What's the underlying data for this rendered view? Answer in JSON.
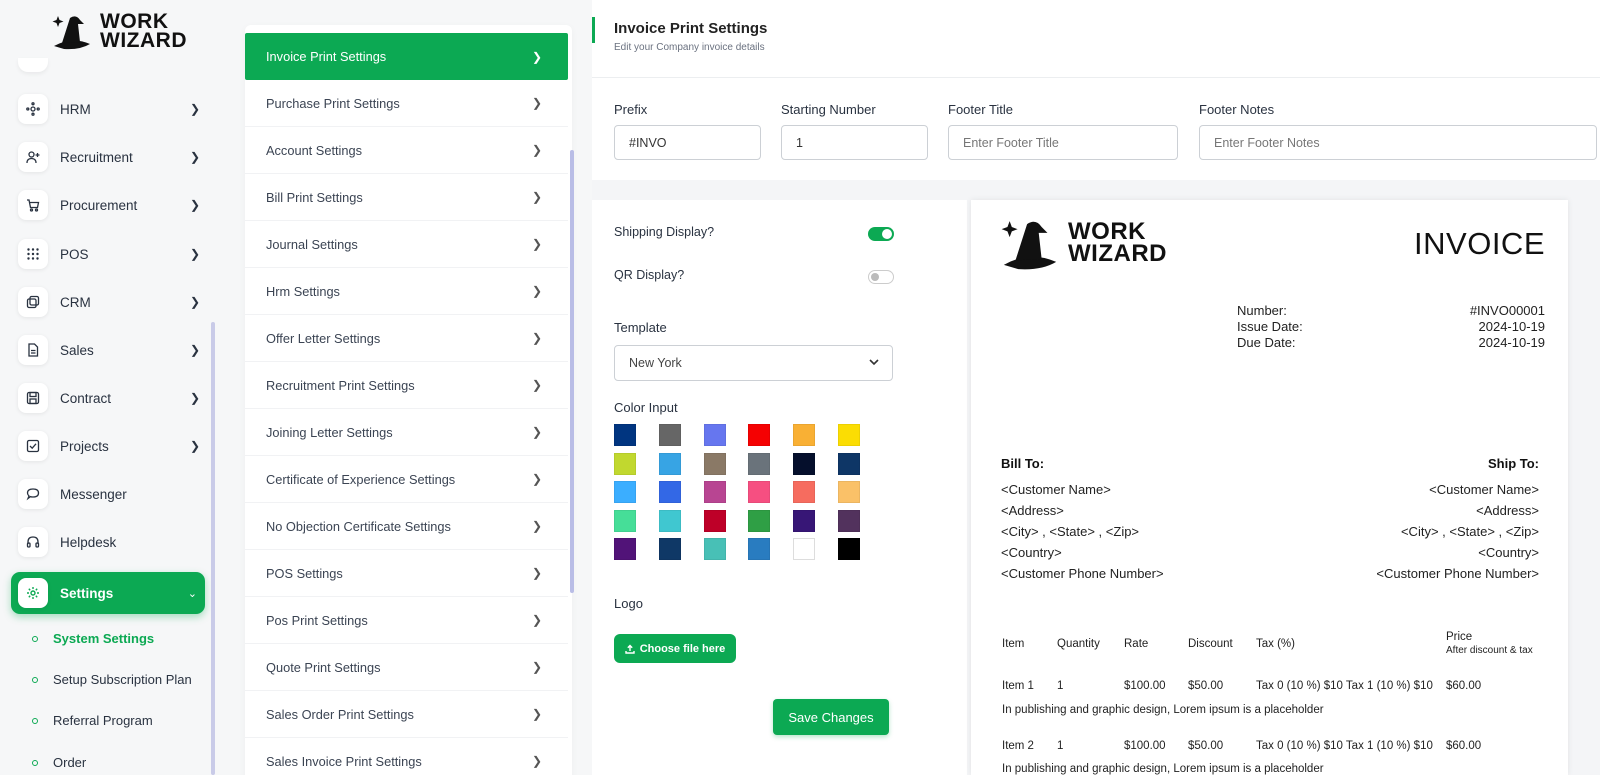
{
  "brand": {
    "line1": "WORK",
    "line2": "WIZARD"
  },
  "sidebar": {
    "items": [
      {
        "label": "HRM",
        "icon": "hrm-icon"
      },
      {
        "label": "Recruitment",
        "icon": "user-plus-icon"
      },
      {
        "label": "Procurement",
        "icon": "cart-icon"
      },
      {
        "label": "POS",
        "icon": "grid-icon"
      },
      {
        "label": "CRM",
        "icon": "layers-icon"
      },
      {
        "label": "Sales",
        "icon": "file-icon"
      },
      {
        "label": "Contract",
        "icon": "save-icon"
      },
      {
        "label": "Projects",
        "icon": "check-square-icon"
      },
      {
        "label": "Messenger",
        "icon": "chat-icon"
      },
      {
        "label": "Helpdesk",
        "icon": "headphones-icon"
      }
    ],
    "active": {
      "label": "Settings",
      "icon": "gear-icon"
    },
    "sub_items": [
      "System Settings",
      "Setup Subscription Plan",
      "Referral Program",
      "Order"
    ]
  },
  "settings_list": [
    "Invoice Print Settings",
    "Purchase Print Settings",
    "Account Settings",
    "Bill Print Settings",
    "Journal Settings",
    "Hrm Settings",
    "Offer Letter Settings",
    "Recruitment Print Settings",
    "Joining Letter Settings",
    "Certificate of Experience Settings",
    "No Objection Certificate Settings",
    "POS Settings",
    "Pos Print Settings",
    "Quote Print Settings",
    "Sales Order Print Settings",
    "Sales Invoice Print Settings"
  ],
  "panel": {
    "title": "Invoice Print Settings",
    "subtitle": "Edit your Company invoice details",
    "fields": {
      "prefix": {
        "label": "Prefix",
        "value": "#INVO"
      },
      "starting_number": {
        "label": "Starting Number",
        "value": "1"
      },
      "footer_title": {
        "label": "Footer Title",
        "placeholder": "Enter Footer Title"
      },
      "footer_notes": {
        "label": "Footer Notes",
        "placeholder": "Enter Footer Notes"
      }
    },
    "shipping_label": "Shipping Display?",
    "shipping_on": true,
    "qr_label": "QR Display?",
    "qr_on": false,
    "template_label": "Template",
    "template_value": "New York",
    "color_label": "Color Input",
    "colors": [
      "#003580",
      "#666666",
      "#6676ef",
      "#f50102",
      "#f9b034",
      "#fbdd03",
      "#c1d82f",
      "#37a4e4",
      "#8a7966",
      "#6a737b",
      "#050f2c",
      "#0e3666",
      "#3baeff",
      "#3368e6",
      "#b84592",
      "#f64f81",
      "#f66c5f",
      "#fac168",
      "#46de98",
      "#40c7d0",
      "#be0028",
      "#2f9f45",
      "#371676",
      "#52325d",
      "#511378",
      "#0f3866",
      "#48c0b6",
      "#297cc0",
      "#ffffff",
      "#000000"
    ],
    "logo_label": "Logo",
    "choose_file": "Choose file here",
    "save": "Save Changes"
  },
  "invoice": {
    "heading": "INVOICE",
    "meta": [
      {
        "label": "Number:",
        "value": "#INVO00001"
      },
      {
        "label": "Issue Date:",
        "value": "2024-10-19"
      },
      {
        "label": "Due Date:",
        "value": "2024-10-19"
      }
    ],
    "bill_to": "Bill To:",
    "ship_to": "Ship To:",
    "address_lines": [
      "<Customer Name>",
      "<Address>",
      "<City> , <State> , <Zip>",
      "<Country>",
      "<Customer Phone Number>"
    ],
    "columns": {
      "item": "Item",
      "quantity": "Quantity",
      "rate": "Rate",
      "discount": "Discount",
      "tax": "Tax (%)",
      "price": "Price",
      "price_sub": "After discount & tax"
    },
    "rows": [
      {
        "item": "Item 1",
        "qty": "1",
        "rate": "$100.00",
        "discount": "$50.00",
        "tax": "Tax 0 (10 %) $10 Tax 1 (10 %) $10",
        "price": "$60.00",
        "desc": "In publishing and graphic design, Lorem ipsum is a placeholder"
      },
      {
        "item": "Item 2",
        "qty": "1",
        "rate": "$100.00",
        "discount": "$50.00",
        "tax": "Tax 0 (10 %) $10 Tax 1 (10 %) $10",
        "price": "$60.00",
        "desc": "In publishing and graphic design, Lorem ipsum is a placeholder"
      }
    ]
  }
}
